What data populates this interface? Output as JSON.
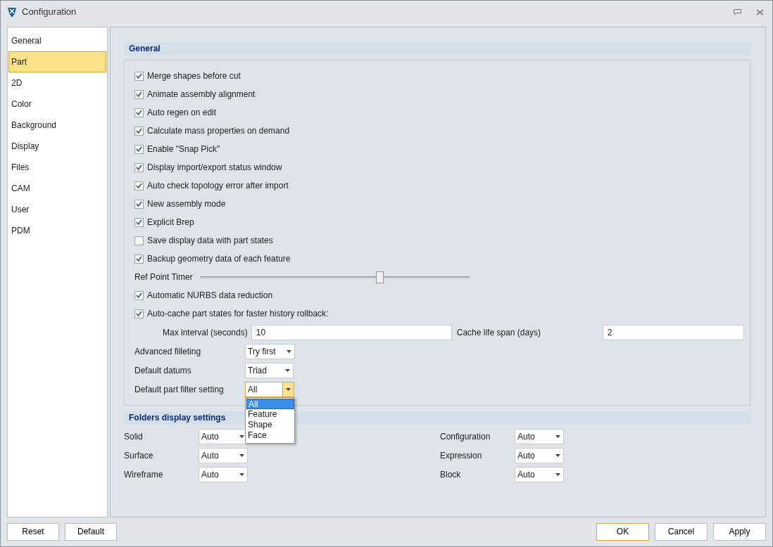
{
  "window": {
    "title": "Configuration"
  },
  "sidebar": {
    "items": [
      {
        "label": "General",
        "selected": false
      },
      {
        "label": "Part",
        "selected": true
      },
      {
        "label": "2D",
        "selected": false
      },
      {
        "label": "Color",
        "selected": false
      },
      {
        "label": "Background",
        "selected": false
      },
      {
        "label": "Display",
        "selected": false
      },
      {
        "label": "Files",
        "selected": false
      },
      {
        "label": "CAM",
        "selected": false
      },
      {
        "label": "User",
        "selected": false
      },
      {
        "label": "PDM",
        "selected": false
      }
    ]
  },
  "general": {
    "title": "General",
    "items": [
      {
        "kind": "checkbox",
        "label": "Merge shapes before cut",
        "checked": true
      },
      {
        "kind": "checkbox",
        "label": "Animate assembly alignment",
        "checked": true
      },
      {
        "kind": "checkbox",
        "label": "Auto regen on edit",
        "checked": true
      },
      {
        "kind": "checkbox",
        "label": "Calculate mass properties on demand",
        "checked": true
      },
      {
        "kind": "checkbox",
        "label": "Enable \"Snap Pick\"",
        "checked": true
      },
      {
        "kind": "checkbox",
        "label": "Display import/export status window",
        "checked": true
      },
      {
        "kind": "checkbox",
        "label": "Auto check topology error after import",
        "checked": true
      },
      {
        "kind": "checkbox",
        "label": "New assembly mode",
        "checked": true
      },
      {
        "kind": "checkbox",
        "label": "Explicit Brep",
        "checked": true
      },
      {
        "kind": "checkbox",
        "label": "Save display data with part states",
        "checked": false
      },
      {
        "kind": "checkbox",
        "label": "Backup geometry data of each feature",
        "checked": true
      },
      {
        "kind": "slider",
        "label": "Ref Point Timer",
        "level": 0.665
      },
      {
        "kind": "checkbox",
        "label": "Automatic NURBS data reduction",
        "checked": true
      },
      {
        "kind": "checkbox",
        "label": "Auto-cache part states for faster history rollback:",
        "checked": true
      }
    ],
    "fields": [
      {
        "label": "Max interval (seconds)",
        "value": "10"
      },
      {
        "label": "Cache life span (days)",
        "value": "2"
      }
    ],
    "combos": [
      {
        "label": "Advanced filleting",
        "value": "Try first",
        "open": false
      },
      {
        "label": "Default datums",
        "value": "Triad",
        "open": false
      },
      {
        "label": "Default part filter setting",
        "value": "All",
        "open": true,
        "options": [
          {
            "label": "All",
            "selected": true
          },
          {
            "label": "Feature",
            "selected": false
          },
          {
            "label": "Shape",
            "selected": false
          },
          {
            "label": "Face",
            "selected": false
          }
        ]
      }
    ]
  },
  "folders": {
    "title": "Folders display settings",
    "left": [
      {
        "label": "Solid",
        "value": "Auto"
      },
      {
        "label": "Surface",
        "value": "Auto"
      },
      {
        "label": "Wireframe",
        "value": "Auto"
      }
    ],
    "right": [
      {
        "label": "Configuration",
        "value": "Auto"
      },
      {
        "label": "Expression",
        "value": "Auto"
      },
      {
        "label": "Block",
        "value": "Auto"
      }
    ]
  },
  "buttons": {
    "left": [
      {
        "label": "Reset",
        "default": false
      },
      {
        "label": "Default",
        "default": false
      }
    ],
    "right": [
      {
        "label": "OK",
        "default": true
      },
      {
        "label": "Cancel",
        "default": false
      },
      {
        "label": "Apply",
        "default": false
      }
    ]
  }
}
